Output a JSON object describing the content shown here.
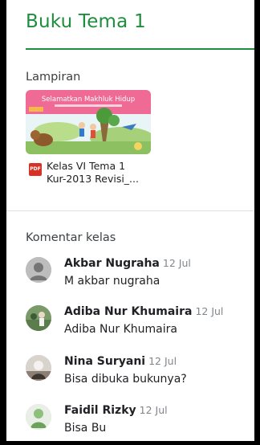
{
  "header": {
    "title": "Buku Tema 1"
  },
  "attachments": {
    "section_label": "Lampiran",
    "thumbnail_title": "Selamatkan Makhluk Hidup",
    "file_name_line1": "Kelas VI Tema 1",
    "file_name_line2": "Kur-2013 Revisi_...",
    "file_type": "PDF"
  },
  "comments": {
    "section_label": "Komentar kelas",
    "items": [
      {
        "author": "Akbar Nugraha",
        "date": "12 Jul",
        "text": "M akbar nugraha",
        "avatar": "default-person-icon"
      },
      {
        "author": "Adiba Nur Khumaira",
        "date": "12 Jul",
        "text": "Adiba Nur Khumaira",
        "avatar": "profile-photo"
      },
      {
        "author": "Nina Suryani",
        "date": "12 Jul",
        "text": "Bisa dibuka bukunya?",
        "avatar": "profile-photo"
      },
      {
        "author": "Faidil Rizky",
        "date": "12 Jul",
        "text": "Bisa Bu",
        "avatar": "profile-photo"
      }
    ]
  },
  "colors": {
    "accent": "#1e8e3e",
    "pdf_red": "#d93025",
    "divider": "#e0e0e0",
    "meta_gray": "#80868b"
  }
}
